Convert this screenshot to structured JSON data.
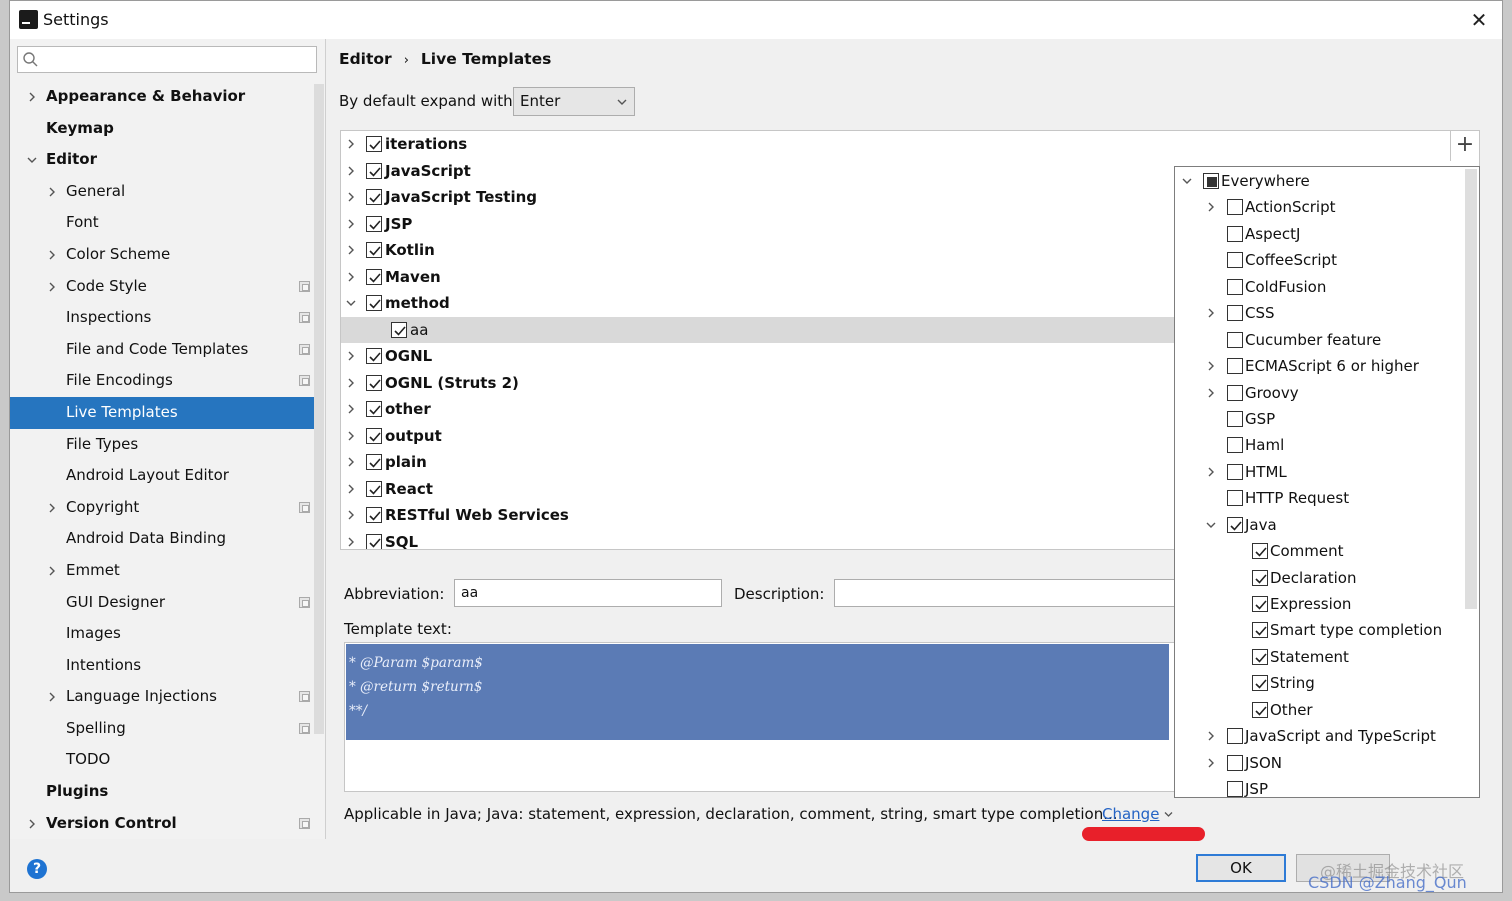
{
  "window": {
    "title": "Settings",
    "close_label": "✕"
  },
  "search": {
    "placeholder": ""
  },
  "nav": [
    {
      "label": "Appearance & Behavior",
      "level": 0,
      "bold": true,
      "chevron": "right",
      "proj": false
    },
    {
      "label": "Keymap",
      "level": 0,
      "bold": true,
      "chevron": "none",
      "proj": false
    },
    {
      "label": "Editor",
      "level": 0,
      "bold": true,
      "chevron": "down",
      "proj": false
    },
    {
      "label": "General",
      "level": 1,
      "bold": false,
      "chevron": "right",
      "proj": false
    },
    {
      "label": "Font",
      "level": 1,
      "bold": false,
      "chevron": "none",
      "proj": false
    },
    {
      "label": "Color Scheme",
      "level": 1,
      "bold": false,
      "chevron": "right",
      "proj": false
    },
    {
      "label": "Code Style",
      "level": 1,
      "bold": false,
      "chevron": "right",
      "proj": true
    },
    {
      "label": "Inspections",
      "level": 1,
      "bold": false,
      "chevron": "none",
      "proj": true
    },
    {
      "label": "File and Code Templates",
      "level": 1,
      "bold": false,
      "chevron": "none",
      "proj": true
    },
    {
      "label": "File Encodings",
      "level": 1,
      "bold": false,
      "chevron": "none",
      "proj": true
    },
    {
      "label": "Live Templates",
      "level": 1,
      "bold": false,
      "chevron": "none",
      "proj": false,
      "selected": true
    },
    {
      "label": "File Types",
      "level": 1,
      "bold": false,
      "chevron": "none",
      "proj": false
    },
    {
      "label": "Android Layout Editor",
      "level": 1,
      "bold": false,
      "chevron": "none",
      "proj": false
    },
    {
      "label": "Copyright",
      "level": 1,
      "bold": false,
      "chevron": "right",
      "proj": true
    },
    {
      "label": "Android Data Binding",
      "level": 1,
      "bold": false,
      "chevron": "none",
      "proj": false
    },
    {
      "label": "Emmet",
      "level": 1,
      "bold": false,
      "chevron": "right",
      "proj": false
    },
    {
      "label": "GUI Designer",
      "level": 1,
      "bold": false,
      "chevron": "none",
      "proj": true
    },
    {
      "label": "Images",
      "level": 1,
      "bold": false,
      "chevron": "none",
      "proj": false
    },
    {
      "label": "Intentions",
      "level": 1,
      "bold": false,
      "chevron": "none",
      "proj": false
    },
    {
      "label": "Language Injections",
      "level": 1,
      "bold": false,
      "chevron": "right",
      "proj": true
    },
    {
      "label": "Spelling",
      "level": 1,
      "bold": false,
      "chevron": "none",
      "proj": true
    },
    {
      "label": "TODO",
      "level": 1,
      "bold": false,
      "chevron": "none",
      "proj": false
    },
    {
      "label": "Plugins",
      "level": 0,
      "bold": true,
      "chevron": "none",
      "proj": false
    },
    {
      "label": "Version Control",
      "level": 0,
      "bold": true,
      "chevron": "right",
      "proj": true
    }
  ],
  "breadcrumb": {
    "part1": "Editor",
    "sep": "›",
    "part2": "Live Templates"
  },
  "expand": {
    "label": "By default expand with",
    "value": "Enter"
  },
  "add_label": "+",
  "groups": [
    {
      "label": "iterations",
      "checked": true,
      "chevron": "right"
    },
    {
      "label": "JavaScript",
      "checked": true,
      "chevron": "right"
    },
    {
      "label": "JavaScript Testing",
      "checked": true,
      "chevron": "right"
    },
    {
      "label": "JSP",
      "checked": true,
      "chevron": "right"
    },
    {
      "label": "Kotlin",
      "checked": true,
      "chevron": "right"
    },
    {
      "label": "Maven",
      "checked": true,
      "chevron": "right"
    },
    {
      "label": "method",
      "checked": true,
      "chevron": "down"
    },
    {
      "label": "aa",
      "checked": true,
      "chevron": "none",
      "child": true,
      "selected": true
    },
    {
      "label": "OGNL",
      "checked": true,
      "chevron": "right"
    },
    {
      "label": "OGNL (Struts 2)",
      "checked": true,
      "chevron": "right"
    },
    {
      "label": "other",
      "checked": true,
      "chevron": "right"
    },
    {
      "label": "output",
      "checked": true,
      "chevron": "right"
    },
    {
      "label": "plain",
      "checked": true,
      "chevron": "right"
    },
    {
      "label": "React",
      "checked": true,
      "chevron": "right"
    },
    {
      "label": "RESTful Web Services",
      "checked": true,
      "chevron": "right"
    },
    {
      "label": "SQL",
      "checked": true,
      "chevron": "right"
    }
  ],
  "abbreviation": {
    "label": "Abbreviation:",
    "value": "aa"
  },
  "description": {
    "label": "Description:",
    "value": ""
  },
  "template_text": {
    "label": "Template text:",
    "lines": [
      "* @Param $param$",
      "* @return $return$",
      "**/"
    ]
  },
  "applicable": {
    "text": "Applicable in Java; Java: statement, expression, declaration, comment, string, smart type completion...",
    "change_label": "Change"
  },
  "contexts": [
    {
      "label": "Everywhere",
      "level": 0,
      "state": "partial",
      "chevron": "down"
    },
    {
      "label": "ActionScript",
      "level": 1,
      "state": "unchecked",
      "chevron": "right"
    },
    {
      "label": "AspectJ",
      "level": 1,
      "state": "unchecked",
      "chevron": "none"
    },
    {
      "label": "CoffeeScript",
      "level": 1,
      "state": "unchecked",
      "chevron": "none"
    },
    {
      "label": "ColdFusion",
      "level": 1,
      "state": "unchecked",
      "chevron": "none"
    },
    {
      "label": "CSS",
      "level": 1,
      "state": "unchecked",
      "chevron": "right"
    },
    {
      "label": "Cucumber feature",
      "level": 1,
      "state": "unchecked",
      "chevron": "none"
    },
    {
      "label": "ECMAScript 6 or higher",
      "level": 1,
      "state": "unchecked",
      "chevron": "right"
    },
    {
      "label": "Groovy",
      "level": 1,
      "state": "unchecked",
      "chevron": "right"
    },
    {
      "label": "GSP",
      "level": 1,
      "state": "unchecked",
      "chevron": "none"
    },
    {
      "label": "Haml",
      "level": 1,
      "state": "unchecked",
      "chevron": "none"
    },
    {
      "label": "HTML",
      "level": 1,
      "state": "unchecked",
      "chevron": "right"
    },
    {
      "label": "HTTP Request",
      "level": 1,
      "state": "unchecked",
      "chevron": "none"
    },
    {
      "label": "Java",
      "level": 1,
      "state": "checked",
      "chevron": "down"
    },
    {
      "label": "Comment",
      "level": 2,
      "state": "checked",
      "chevron": "none"
    },
    {
      "label": "Declaration",
      "level": 2,
      "state": "checked",
      "chevron": "none"
    },
    {
      "label": "Expression",
      "level": 2,
      "state": "checked",
      "chevron": "none"
    },
    {
      "label": "Smart type completion",
      "level": 2,
      "state": "checked",
      "chevron": "none"
    },
    {
      "label": "Statement",
      "level": 2,
      "state": "checked",
      "chevron": "none"
    },
    {
      "label": "String",
      "level": 2,
      "state": "checked",
      "chevron": "none"
    },
    {
      "label": "Other",
      "level": 2,
      "state": "checked",
      "chevron": "none"
    },
    {
      "label": "JavaScript and TypeScript",
      "level": 1,
      "state": "unchecked",
      "chevron": "right"
    },
    {
      "label": "JSON",
      "level": 1,
      "state": "unchecked",
      "chevron": "right"
    },
    {
      "label": "JSP",
      "level": 1,
      "state": "unchecked",
      "chevron": "none"
    }
  ],
  "buttons": {
    "ok": "OK",
    "help": "?"
  },
  "watermark": {
    "line1": "@稀土掘金技术社区",
    "line2": "CSDN @Zhang_Qun"
  },
  "colors": {
    "selection": "#2675bf",
    "code_bg": "#5b7bb5",
    "link": "#2463c4",
    "annotation": "#e8202a"
  }
}
